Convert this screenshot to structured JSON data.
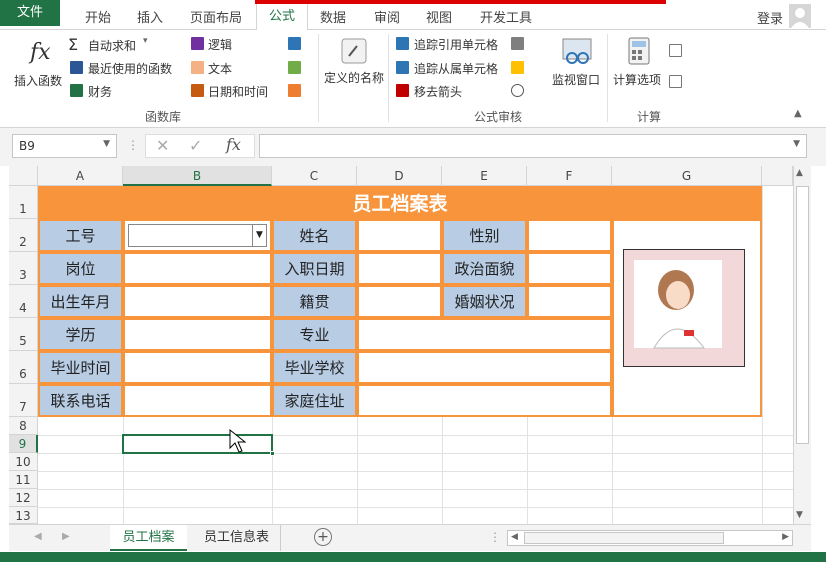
{
  "ribbon_tabs": [
    "文件",
    "开始",
    "插入",
    "页面布局",
    "公式",
    "数据",
    "审阅",
    "视图",
    "开发工具"
  ],
  "active_tab": "公式",
  "account": {
    "login_label": "登录"
  },
  "ribbon": {
    "insert_function": "插入函数",
    "autosum": "自动求和",
    "recent": "最近使用的函数",
    "financial": "财务",
    "logical": "逻辑",
    "text": "文本",
    "datetime": "日期和时间",
    "defined_names": "定义的名称",
    "trace_precedents": "追踪引用单元格",
    "trace_dependents": "追踪从属单元格",
    "remove_arrows": "移去箭头",
    "watch_window": "监视窗口",
    "calc_options": "计算选项",
    "group_function_library": "函数库",
    "group_formula_auditing": "公式审核",
    "group_calculation": "计算"
  },
  "formula_bar": {
    "name_box": "B9",
    "formula": ""
  },
  "columns": [
    "A",
    "B",
    "C",
    "D",
    "E",
    "F",
    "G"
  ],
  "rows": [
    "1",
    "2",
    "3",
    "4",
    "5",
    "6",
    "7",
    "8",
    "9",
    "10",
    "11",
    "12",
    "13"
  ],
  "selected_cell": "B9",
  "table": {
    "title": "员工档案表",
    "labels": {
      "id": "工号",
      "name": "姓名",
      "gender": "性别",
      "position": "岗位",
      "join_date": "入职日期",
      "political": "政治面貌",
      "birth": "出生年月",
      "native": "籍贯",
      "marital": "婚姻状况",
      "education": "学历",
      "major": "专业",
      "grad_time": "毕业时间",
      "school": "毕业学校",
      "phone": "联系电话",
      "address": "家庭住址"
    }
  },
  "sheet_tabs": [
    "员工档案",
    "员工信息表"
  ],
  "active_sheet": "员工档案",
  "colors": {
    "accent": "#217346",
    "orange": "#f7943c",
    "label_bg": "#b8cce4",
    "title_bg": "#f7943c"
  }
}
